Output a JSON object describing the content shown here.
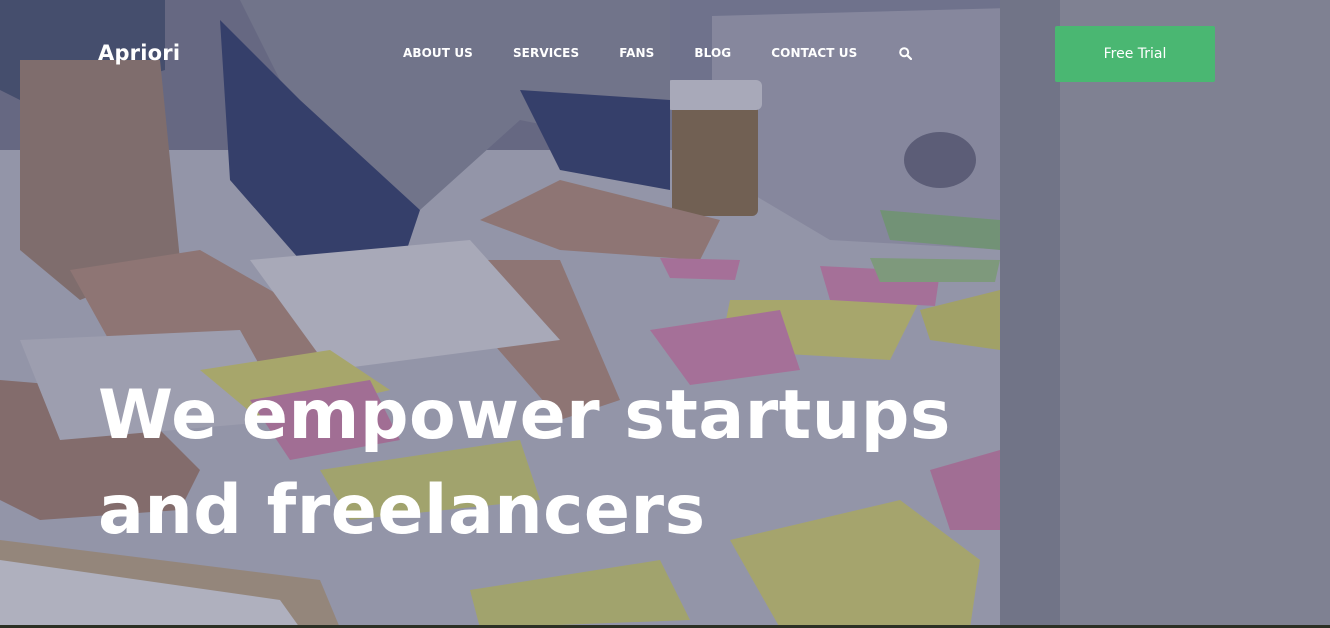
{
  "brand": {
    "logo_text": "Apriori"
  },
  "nav": {
    "items": [
      {
        "label": "ABOUT US"
      },
      {
        "label": "SERVICES"
      },
      {
        "label": "FANS"
      },
      {
        "label": "BLOG"
      },
      {
        "label": "CONTACT US"
      }
    ],
    "search_icon": "search-icon"
  },
  "cta": {
    "label": "Free Trial"
  },
  "hero": {
    "headline_line1": "We empower startups",
    "headline_line2": "and freelancers",
    "background": "photo of team working at a table with sticky notes and laptop"
  },
  "colors": {
    "accent": "#4ab772",
    "text": "#ffffff",
    "overlay": "#2c2e4c"
  }
}
